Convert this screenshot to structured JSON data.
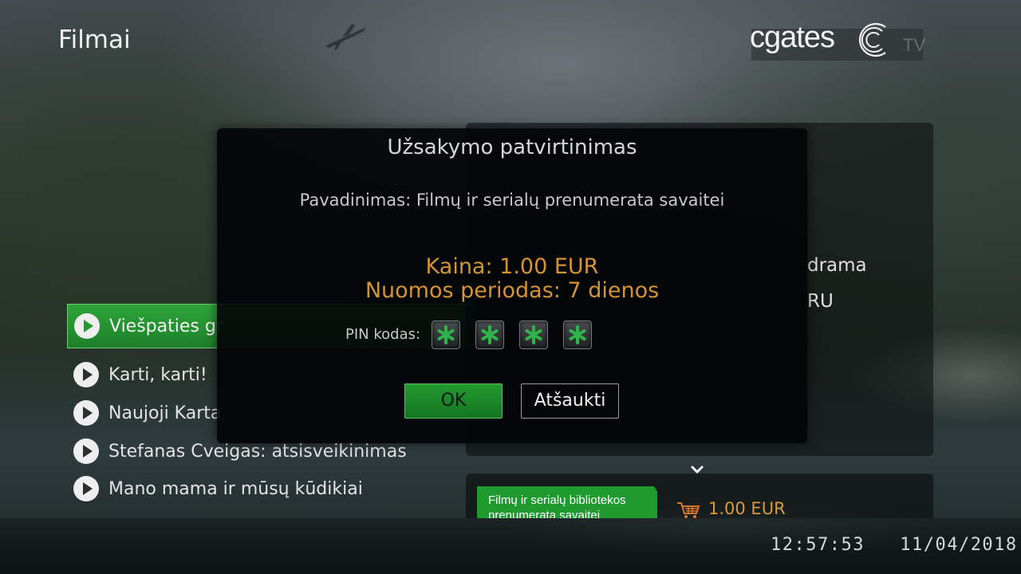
{
  "header": {
    "title": "Filmai",
    "logo_text": "cgates",
    "logo_suffix": "TV"
  },
  "movie_list": {
    "items": [
      {
        "label": "Viešpaties gr",
        "selected": true
      },
      {
        "label": "Karti, karti!",
        "selected": false
      },
      {
        "label": "Naujoji Karta",
        "selected": false
      },
      {
        "label": "Stefanas Cveigas: atsisveikinimas",
        "selected": false
      },
      {
        "label": "Mano mama ir mūsų kūdikiai",
        "selected": false
      }
    ]
  },
  "info_panel": {
    "genre_fragment": "drama",
    "language_fragment": "RU"
  },
  "purchase": {
    "offer_label": "Filmų ir serialų bibliotekos prenumerata savaitei",
    "price": "1.00 EUR"
  },
  "modal": {
    "title": "Užsakymo patvirtinimas",
    "name_line": "Pavadinimas: Filmų ir serialų prenumerata savaitei",
    "price_line": "Kaina: 1.00 EUR",
    "period_line": "Nuomos periodas: 7 dienos",
    "pin_label": "PIN kodas:",
    "pin_digits_entered": 4,
    "ok_label": "OK",
    "cancel_label": "Atšaukti"
  },
  "status_bar": {
    "time": "12:57:53",
    "date": "11/04/2018"
  },
  "colors": {
    "accent_green": "#1f9a2f",
    "price_orange": "#d49334",
    "pin_star_green": "#2fb44a"
  }
}
